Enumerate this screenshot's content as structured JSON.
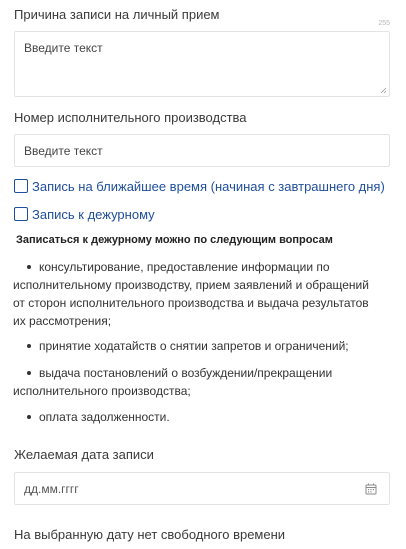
{
  "reason": {
    "label": "Причина записи на личный прием",
    "counter": "255",
    "placeholder": "Введите текст"
  },
  "proceeding": {
    "label": "Номер исполнительного производства",
    "placeholder": "Введите текст"
  },
  "checkboxes": [
    {
      "label": "Запись на ближайшее время (начиная с завтрашнего дня)",
      "checked": false
    },
    {
      "label": "Запись к дежурному",
      "checked": false
    }
  ],
  "duty_info": {
    "heading": "Записаться к дежурному можно по следующим вопросам",
    "items": [
      {
        "lines": [
          "консультирование, предоставление информации по",
          "исполнительному производству, прием заявлений и обращений",
          "от сторон исполнительного производства и выдача результатов",
          "их рассмотрения;"
        ]
      },
      {
        "lines": [
          "принятие ходатайств о снятии запретов и ограничений;"
        ]
      },
      {
        "lines": [
          "выдача постановлений о возбуждении/прекращении",
          "исполнительного производства;"
        ]
      },
      {
        "lines": [
          "оплата задолженности."
        ]
      }
    ]
  },
  "date": {
    "label": "Желаемая дата записи",
    "placeholder": "дд.мм.гггг",
    "icon": "calendar-icon"
  },
  "no_time_message": "На выбранную дату нет свободного времени",
  "colors": {
    "accent": "#1f4e9b",
    "border": "#e3e3e3",
    "text": "#333333"
  }
}
